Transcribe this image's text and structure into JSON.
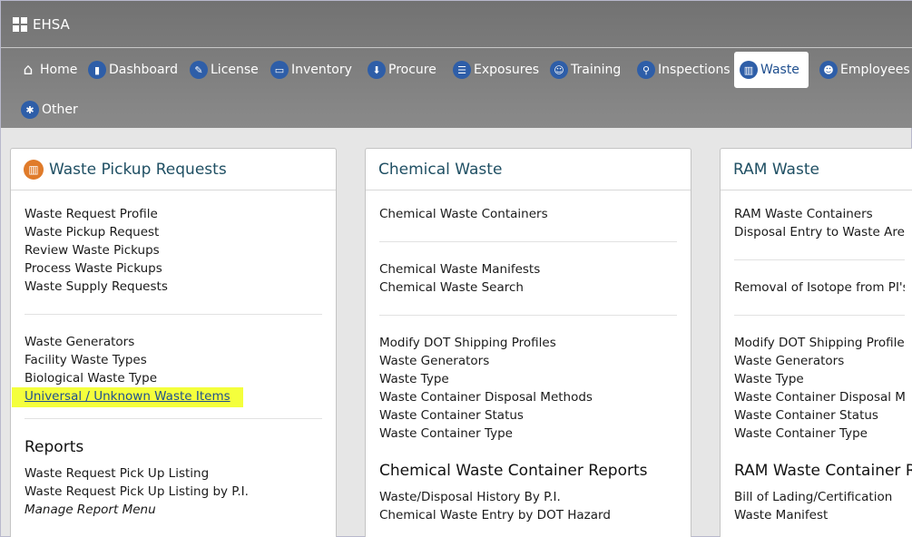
{
  "app": {
    "title": "EHSA"
  },
  "nav": [
    {
      "label": "Home",
      "icon": "home-icon"
    },
    {
      "label": "Dashboard",
      "icon": "bar-chart-icon"
    },
    {
      "label": "License",
      "icon": "wrench-icon"
    },
    {
      "label": "Inventory",
      "icon": "truck-icon"
    },
    {
      "label": "Procure",
      "icon": "arrow-down-icon"
    },
    {
      "label": "Exposures",
      "icon": "clipboard-icon"
    },
    {
      "label": "Training",
      "icon": "person-icon"
    },
    {
      "label": "Inspections",
      "icon": "search-icon"
    },
    {
      "label": "Waste",
      "icon": "trash-icon"
    },
    {
      "label": "Employees",
      "icon": "users-icon"
    },
    {
      "label": "Other",
      "icon": "asterisk-icon"
    }
  ],
  "panels": {
    "pickup": {
      "title": "Waste Pickup Requests",
      "group1": [
        "Waste Request Profile",
        "Waste Pickup Request",
        "Review Waste Pickups",
        "Process Waste Pickups",
        "Waste Supply Requests"
      ],
      "group2": [
        "Waste Generators",
        "Facility Waste Types",
        "Biological Waste Type",
        "Universal / Unknown Waste Items"
      ],
      "reports_title": "Reports",
      "reports": [
        "Waste Request Pick Up Listing",
        "Waste Request Pick Up Listing by P.I.",
        "Manage Report Menu"
      ]
    },
    "chemical": {
      "title": "Chemical Waste",
      "group1": [
        "Chemical Waste Containers"
      ],
      "group2": [
        "Chemical Waste Manifests",
        "Chemical Waste Search"
      ],
      "group3": [
        "Modify DOT Shipping Profiles",
        "Waste Generators",
        "Waste Type",
        "Waste Container Disposal Methods",
        "Waste Container Status",
        "Waste Container Type"
      ],
      "reports_title": "Chemical Waste Container Reports",
      "reports": [
        "Waste/Disposal History By P.I.",
        "Chemical Waste Entry by DOT Hazard"
      ]
    },
    "ram": {
      "title": "RAM Waste",
      "group1": [
        "RAM Waste Containers",
        "Disposal Entry to Waste Area"
      ],
      "group2": [
        "Removal of Isotope from PI's In"
      ],
      "group3": [
        "Modify DOT Shipping Profiles",
        "Waste Generators",
        "Waste Type",
        "Waste Container Disposal Metho",
        "Waste Container Status",
        "Waste Container Type"
      ],
      "reports_title": "RAM Waste Container Re",
      "reports": [
        "Bill of Lading/Certification",
        "Waste Manifest"
      ]
    }
  }
}
